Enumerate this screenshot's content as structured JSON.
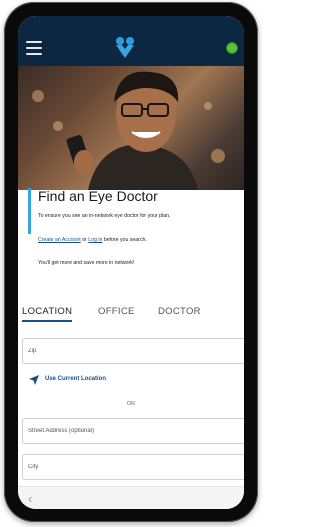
{
  "find": {
    "title": "Find an Eye Doctor",
    "subtitle": "To ensure you see an in-network eye doctor for your plan,",
    "create_link": "Create an Account",
    "or_word": "or",
    "login_link": "Log in",
    "links_suffix": "before you search.",
    "more_text": "You'll get more and save more in network!"
  },
  "tabs": [
    "LOCATION",
    "OFFICE",
    "DOCTOR"
  ],
  "form": {
    "zip_placeholder": "Zip",
    "use_location_label": "Use Current Location",
    "or_label": "OR",
    "street_placeholder": "Street Address (optional)",
    "city_placeholder": "City"
  },
  "icons": {
    "menu": "hamburger-menu-icon",
    "logo": "heart-logo-icon",
    "location": "location-arrow-icon",
    "back": "chevron-left-icon"
  },
  "colors": {
    "header_bg": "#0c2742",
    "accent_blue": "#3aa5dd",
    "link_blue": "#1a4f86",
    "status_green": "#58c23a"
  }
}
